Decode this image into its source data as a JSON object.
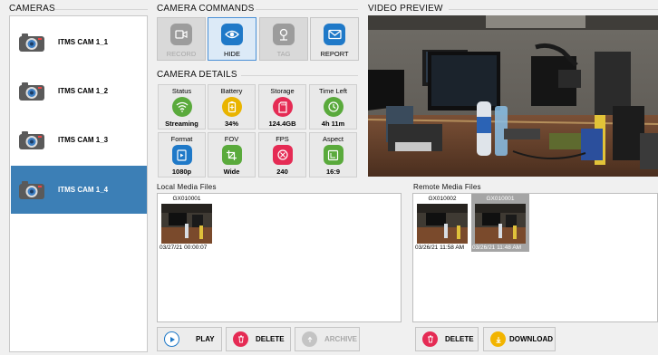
{
  "sections": {
    "cameras": "CAMERAS",
    "commands": "CAMERA COMMANDS",
    "details": "CAMERA DETAILS",
    "preview": "VIDEO PREVIEW",
    "local_media": "Local Media Files",
    "remote_media": "Remote Media Files"
  },
  "cameras": [
    {
      "label": "ITMS CAM 1_1",
      "selected": false
    },
    {
      "label": "ITMS CAM 1_2",
      "selected": false
    },
    {
      "label": "ITMS CAM 1_3",
      "selected": false
    },
    {
      "label": "ITMS CAM 1_4",
      "selected": true
    }
  ],
  "commands": [
    {
      "label": "RECORD",
      "icon": "video-camera-icon",
      "state": "disabled",
      "color": "#9c9c9c"
    },
    {
      "label": "HIDE",
      "icon": "eye-icon",
      "state": "active",
      "color": "#1f79c8"
    },
    {
      "label": "TAG",
      "icon": "tag-pin-icon",
      "state": "disabled",
      "color": "#9c9c9c"
    },
    {
      "label": "REPORT",
      "icon": "envelope-icon",
      "state": "normal",
      "color": "#1f79c8"
    }
  ],
  "details": [
    {
      "head": "Status",
      "value": "Streaming",
      "icon": "wifi-icon",
      "color": "#5aaa3c"
    },
    {
      "head": "Battery",
      "value": "34%",
      "icon": "battery-icon",
      "color": "#e9b400"
    },
    {
      "head": "Storage",
      "value": "124.4GB",
      "icon": "sd-card-icon",
      "color": "#e52b54"
    },
    {
      "head": "Time Left",
      "value": "4h 11m",
      "icon": "clock-icon",
      "color": "#5aaa3c"
    },
    {
      "head": "Format",
      "value": "1080p",
      "icon": "film-icon",
      "color": "#1f79c8"
    },
    {
      "head": "FOV",
      "value": "Wide",
      "icon": "crop-icon",
      "color": "#5aaa3c"
    },
    {
      "head": "FPS",
      "value": "240",
      "icon": "speed-icon",
      "color": "#e52b54"
    },
    {
      "head": "Aspect",
      "value": "16:9",
      "icon": "aspect-icon",
      "color": "#5aaa3c"
    }
  ],
  "local_files": [
    {
      "name": "GX010001",
      "date": "03/27/21 00:00:07"
    }
  ],
  "remote_files": [
    {
      "name": "GX010002",
      "date": "03/26/21 11:58 AM",
      "selected": false
    },
    {
      "name": "GX010001",
      "date": "03/26/21 11:48 AM",
      "selected": true
    }
  ],
  "local_actions": {
    "play": "PLAY",
    "delete": "DELETE",
    "archive": "ARCHIVE"
  },
  "remote_actions": {
    "delete": "DELETE",
    "download": "DOWNLOAD"
  },
  "colors": {
    "accent": "#3c7fb6",
    "play": "#1f79c8",
    "delete": "#e52b54",
    "download": "#f2b400"
  }
}
